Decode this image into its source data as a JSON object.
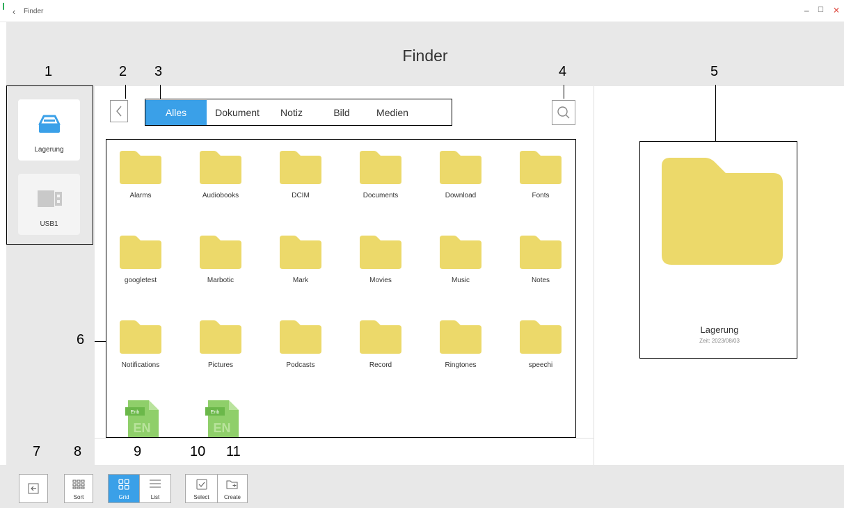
{
  "window": {
    "title": "Finder",
    "minimize": "–",
    "maximize": "☐",
    "close": "✕"
  },
  "app": {
    "title": "Finder"
  },
  "sidebar": {
    "items": [
      {
        "label": "Lagerung",
        "icon": "storage-drive-icon",
        "active": true
      },
      {
        "label": "USB1",
        "icon": "usb-drive-icon",
        "active": false
      }
    ]
  },
  "tabs": [
    {
      "label": "Alles",
      "active": true
    },
    {
      "label": "Dokument",
      "active": false
    },
    {
      "label": "Notiz",
      "active": false
    },
    {
      "label": "Bild",
      "active": false
    },
    {
      "label": "Medien",
      "active": false
    }
  ],
  "files": [
    {
      "name": "Alarms",
      "type": "folder"
    },
    {
      "name": "Audiobooks",
      "type": "folder"
    },
    {
      "name": "DCIM",
      "type": "folder"
    },
    {
      "name": "Documents",
      "type": "folder"
    },
    {
      "name": "Download",
      "type": "folder"
    },
    {
      "name": "Fonts",
      "type": "folder"
    },
    {
      "name": "googletest",
      "type": "folder"
    },
    {
      "name": "Marbotic",
      "type": "folder"
    },
    {
      "name": "Mark",
      "type": "folder"
    },
    {
      "name": "Movies",
      "type": "folder"
    },
    {
      "name": "Music",
      "type": "folder"
    },
    {
      "name": "Notes",
      "type": "folder"
    },
    {
      "name": "Notifications",
      "type": "folder"
    },
    {
      "name": "Pictures",
      "type": "folder"
    },
    {
      "name": "Podcasts",
      "type": "folder"
    },
    {
      "name": "Record",
      "type": "folder"
    },
    {
      "name": "Ringtones",
      "type": "folder"
    },
    {
      "name": "speechi",
      "type": "folder"
    },
    {
      "name": "",
      "type": "enb-file",
      "badge": "Enb",
      "glyph": "EN"
    },
    {
      "name": "",
      "type": "enb-file",
      "badge": "Enb",
      "glyph": "EN"
    }
  ],
  "detail": {
    "name": "Lagerung",
    "time": "Zeit: 2023/08/03"
  },
  "toolbar": {
    "sort": "Sort",
    "grid": "Grid",
    "list": "List",
    "select": "Select",
    "create": "Create"
  },
  "annotations": [
    "1",
    "2",
    "3",
    "4",
    "5",
    "6",
    "7",
    "8",
    "9",
    "10",
    "11"
  ],
  "colors": {
    "accent": "#3aa0e8",
    "folder": "#ecd96a",
    "enb_file": "#8fcf6a",
    "panel_bg": "#e8e8e8"
  }
}
